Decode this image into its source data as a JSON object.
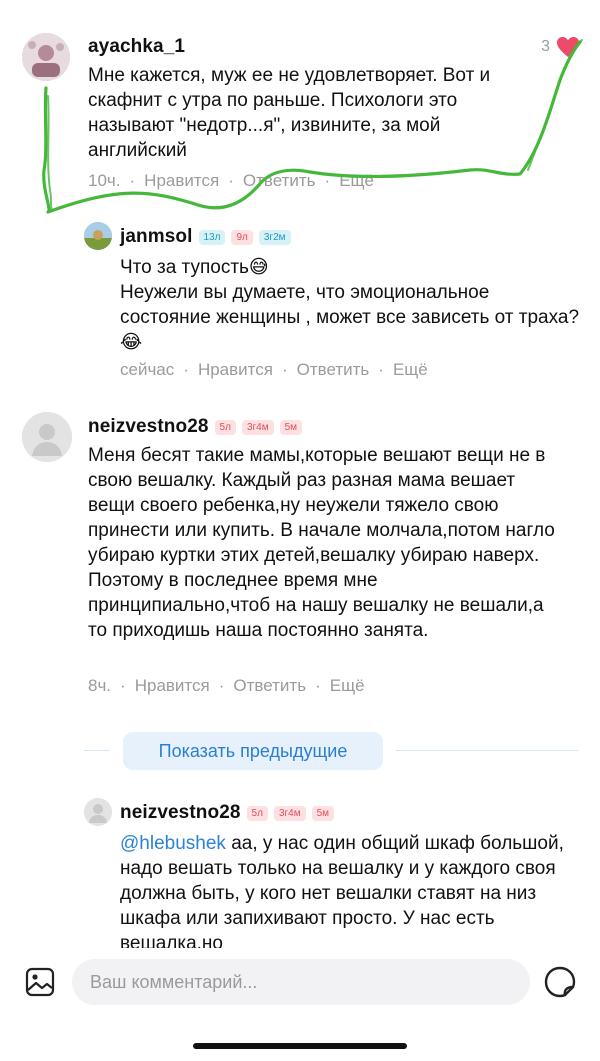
{
  "comments": [
    {
      "author": "ayachka_1",
      "likes": "3",
      "text": "Мне кажется, муж ее не удовлетворяет. Вот и скафнит с утра по раньше. Психологи это называют \"недотр...я\", извините, за мой английский",
      "time": "10ч.",
      "like_label": "Нравится",
      "reply_label": "Ответить",
      "more_label": "Ещё"
    },
    {
      "author": "janmsol",
      "badges": [
        "13л",
        "9л",
        "3г2м"
      ],
      "text_line1": "Что за тупость😅",
      "text_rest": "Неужели вы думаете, что эмоциональное состояние женщины , может все  зависеть от траха?😂",
      "time": "сейчас",
      "like_label": "Нравится",
      "reply_label": "Ответить",
      "more_label": "Ещё"
    },
    {
      "author": "neizvestno28",
      "badges": [
        "5л",
        "3г4м",
        "5м"
      ],
      "text": "Меня бесят такие мамы,которые вешают вещи не в свою вешалку. Каждый раз разная мама вешает вещи своего ребенка,ну неужели тяжело свою принести или купить. В начале молчала,потом нагло убираю куртки этих детей,вешалку убираю наверх. Поэтому в последнее время мне принципиально,чтоб на нашу вешалку не вешали,а то приходишь наша постоянно занята.",
      "time": "8ч.",
      "like_label": "Нравится",
      "reply_label": "Ответить",
      "more_label": "Ещё"
    },
    {
      "author": "neizvestno28",
      "badges": [
        "5л",
        "3г4м",
        "5м"
      ],
      "mention": "@hlebushek",
      "text": " аа, у нас один общий шкаф большой, надо вешать только на вешалку и у каждого своя должна быть, у кого нет вешалки ставят на низ шкафа или запихивают просто. У нас есть вешалка,но"
    }
  ],
  "show_previous": "Показать предыдущие",
  "composer": {
    "placeholder": "Ваш комментарий..."
  },
  "colors": {
    "heart": "#ee4a6a",
    "link": "#2a7fd1",
    "annotation_stroke": "#3fb83a"
  },
  "icons": [
    "image-icon",
    "sticker-icon",
    "heart-icon"
  ]
}
